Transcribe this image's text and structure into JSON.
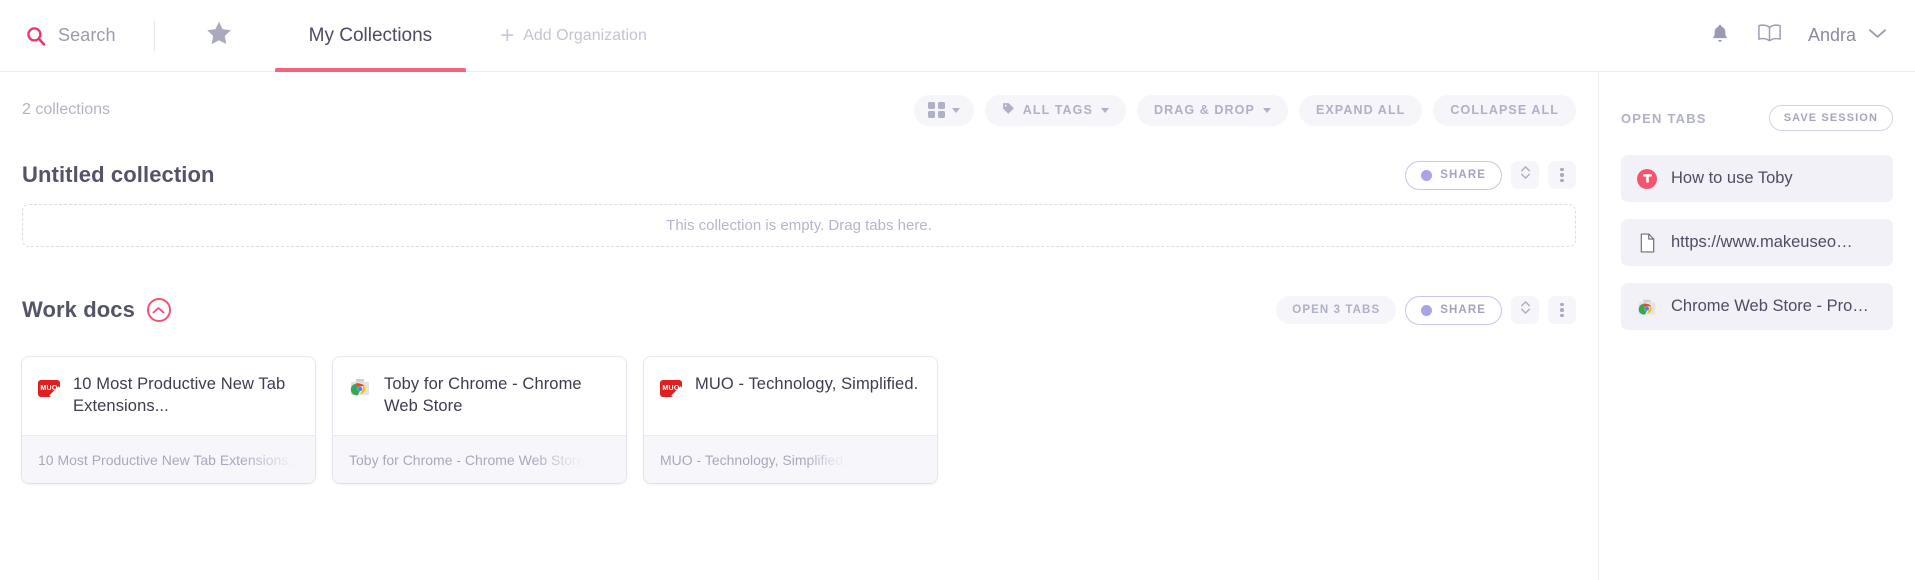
{
  "nav": {
    "search_label": "Search",
    "search_icon": "search-icon",
    "star_icon": "star-icon",
    "tab_my_collections": "My Collections",
    "add_organization": "Add Organization",
    "plus_glyph": "+",
    "bell_icon": "bell-icon",
    "book_icon": "book-icon",
    "user_name": "Andra",
    "chevron_icon": "chevron-down-icon",
    "accent_color": "#f4647d"
  },
  "toolbar": {
    "collection_count": "2 collections",
    "view_toggle_icon": "grid-view-icon",
    "all_tags": "ALL TAGS",
    "tag_icon": "tag-icon",
    "drag_drop": "DRAG & DROP",
    "expand_all": "EXPAND ALL",
    "collapse_all": "COLLAPSE ALL"
  },
  "collections": [
    {
      "title": "Untitled collection",
      "has_collapse_icon": false,
      "open_tabs_label": null,
      "share_label": "SHARE",
      "empty_message": "This collection is empty. Drag tabs here.",
      "cards": []
    },
    {
      "title": "Work docs",
      "has_collapse_icon": true,
      "collapse_icon": "chevron-up-circle-icon",
      "open_tabs_label": "OPEN 3 TABS",
      "share_label": "SHARE",
      "empty_message": null,
      "cards": [
        {
          "title": "10 Most Productive New Tab Extensions...",
          "url": "10 Most Productive New Tab Extensions...",
          "favicon": "muo-favicon",
          "favicon_text": "MUO"
        },
        {
          "title": "Toby for Chrome - Chrome Web Store",
          "url": "Toby for Chrome - Chrome Web Store",
          "favicon": "chrome-web-store-favicon",
          "favicon_text": ""
        },
        {
          "title": "MUO - Technology, Simplified.",
          "url": "MUO - Technology, Simplified.",
          "favicon": "muo-favicon",
          "favicon_text": "MUO"
        }
      ]
    }
  ],
  "sidebar": {
    "title": "OPEN TABS",
    "save_session": "SAVE SESSION",
    "tabs": [
      {
        "label": "How to use Toby",
        "icon": "toby-favicon"
      },
      {
        "label": "https://www.makeuseo…",
        "icon": "document-favicon"
      },
      {
        "label": "Chrome Web Store - Pro…",
        "icon": "chrome-web-store-favicon"
      }
    ]
  }
}
